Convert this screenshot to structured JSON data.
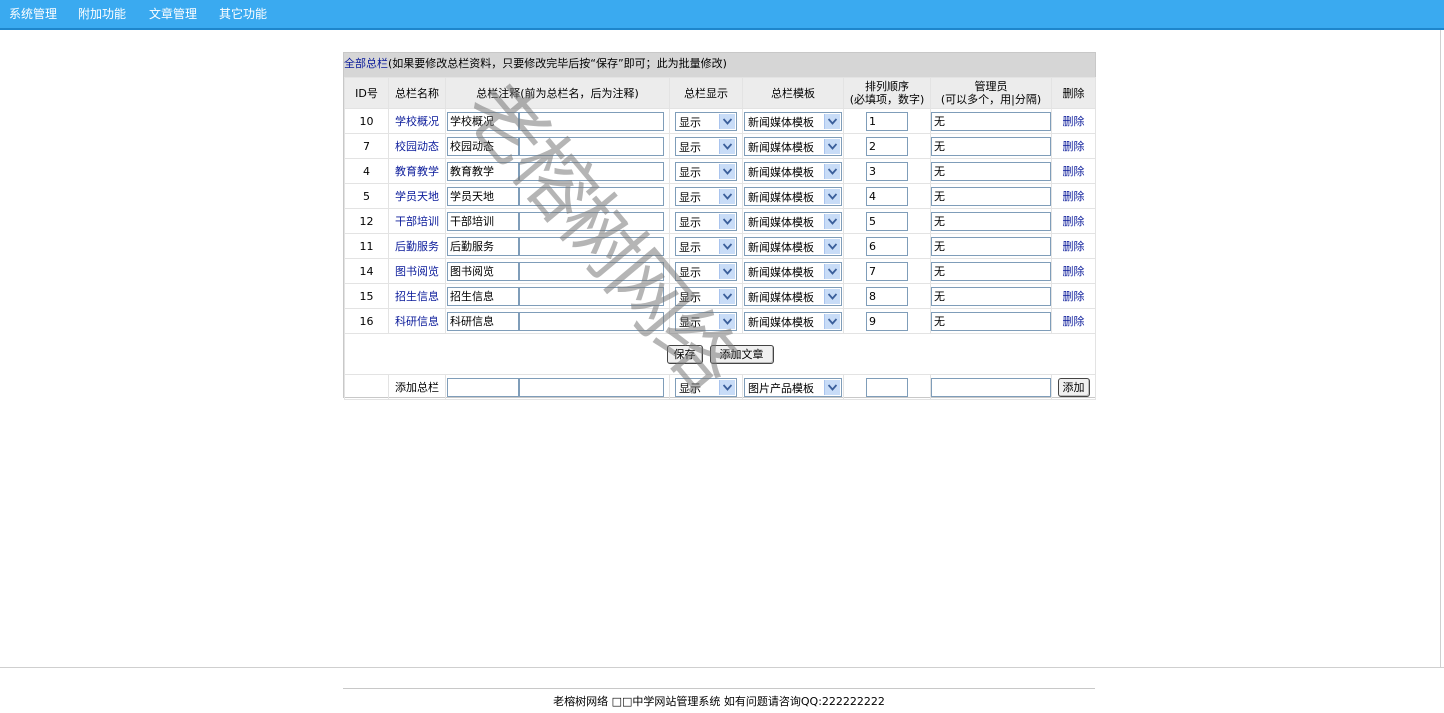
{
  "nav": [
    "系统管理",
    "附加功能",
    "文章管理",
    "其它功能"
  ],
  "head": {
    "link": "全部总栏",
    "note": "(如果要修改总栏资料，只要修改完毕后按“保存”即可；此为批量修改)"
  },
  "columns": {
    "id": "ID号",
    "name": "总栏名称",
    "comment": "总栏注释(前为总栏名，后为注释)",
    "show": "总栏显示",
    "template": "总栏模板",
    "order_1": "排列顺序",
    "order_2": "(必填项，数字)",
    "admin_1": "管理员",
    "admin_2": "(可以多个，用|分隔)",
    "delete": "删除"
  },
  "rows": [
    {
      "id": "10",
      "name": "学校概况",
      "comment": "学校概况",
      "note": "",
      "show": "显示",
      "template": "新闻媒体模板",
      "order": "1",
      "admin": "无",
      "delete": "删除"
    },
    {
      "id": "7",
      "name": "校园动态",
      "comment": "校园动态",
      "note": "",
      "show": "显示",
      "template": "新闻媒体模板",
      "order": "2",
      "admin": "无",
      "delete": "删除"
    },
    {
      "id": "4",
      "name": "教育教学",
      "comment": "教育教学",
      "note": "",
      "show": "显示",
      "template": "新闻媒体模板",
      "order": "3",
      "admin": "无",
      "delete": "删除"
    },
    {
      "id": "5",
      "name": "学员天地",
      "comment": "学员天地",
      "note": "",
      "show": "显示",
      "template": "新闻媒体模板",
      "order": "4",
      "admin": "无",
      "delete": "删除"
    },
    {
      "id": "12",
      "name": "干部培训",
      "comment": "干部培训",
      "note": "",
      "show": "显示",
      "template": "新闻媒体模板",
      "order": "5",
      "admin": "无",
      "delete": "删除"
    },
    {
      "id": "11",
      "name": "后勤服务",
      "comment": "后勤服务",
      "note": "",
      "show": "显示",
      "template": "新闻媒体模板",
      "order": "6",
      "admin": "无",
      "delete": "删除"
    },
    {
      "id": "14",
      "name": "图书阅览",
      "comment": "图书阅览",
      "note": "",
      "show": "显示",
      "template": "新闻媒体模板",
      "order": "7",
      "admin": "无",
      "delete": "删除"
    },
    {
      "id": "15",
      "name": "招生信息",
      "comment": "招生信息",
      "note": "",
      "show": "显示",
      "template": "新闻媒体模板",
      "order": "8",
      "admin": "无",
      "delete": "删除"
    },
    {
      "id": "16",
      "name": "科研信息",
      "comment": "科研信息",
      "note": "",
      "show": "显示",
      "template": "新闻媒体模板",
      "order": "9",
      "admin": "无",
      "delete": "删除"
    }
  ],
  "actions": {
    "save": "保存",
    "add_article": "添加文章"
  },
  "add_row": {
    "label": "添加总栏",
    "show": "显示",
    "template": "图片产品模板",
    "button": "添加"
  },
  "watermark": "老榕树网络",
  "footer": "老榕树网络 □□中学网站管理系统  如有问题请咨询QQ:222222222"
}
